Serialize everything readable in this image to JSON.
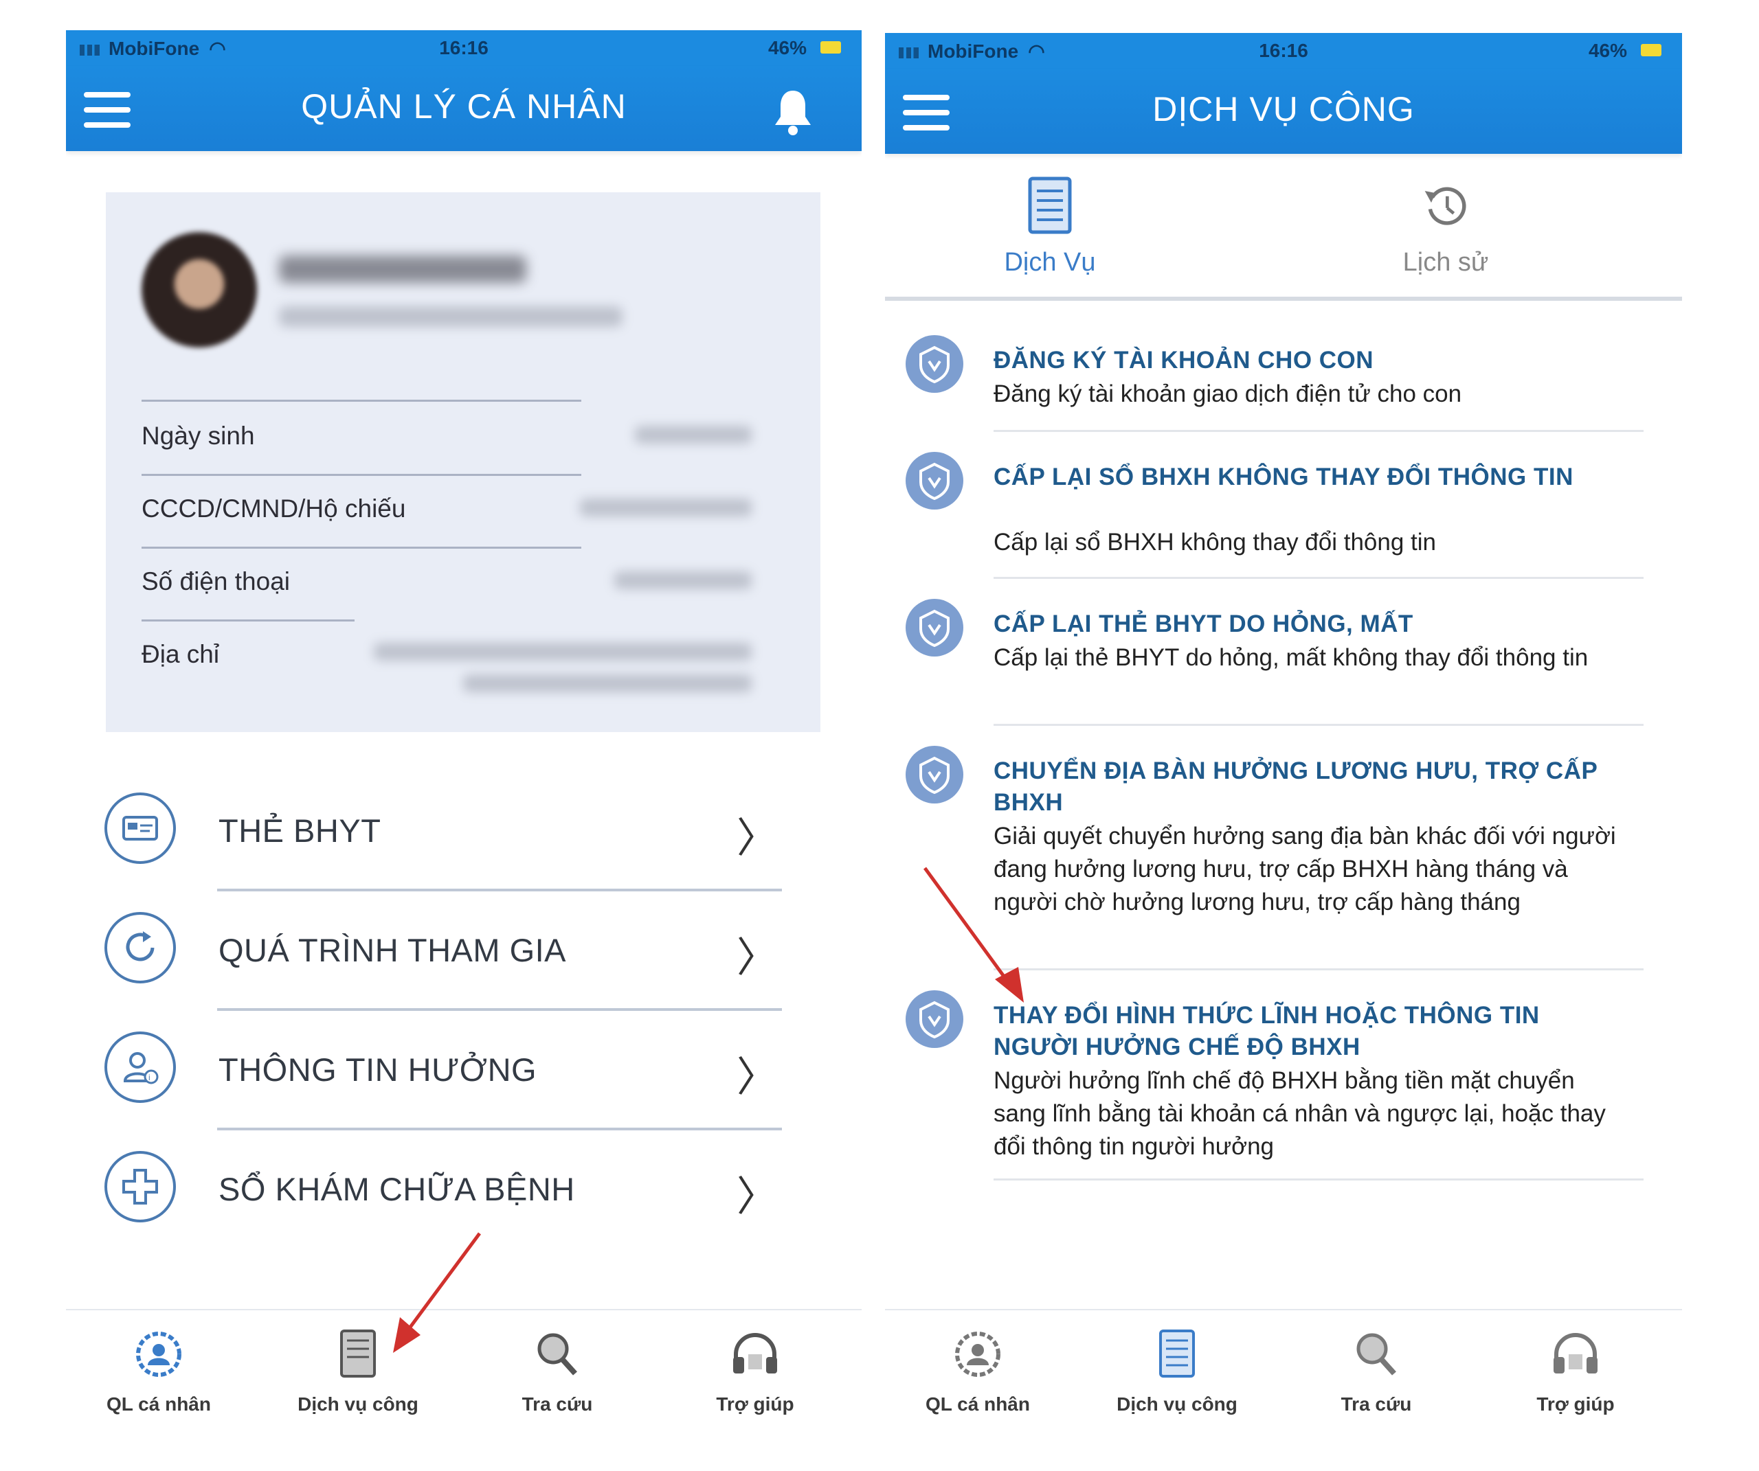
{
  "left": {
    "status": {
      "carrier": "MobiFone",
      "time": "16:16",
      "battery": "46%"
    },
    "title": "QUẢN LÝ CÁ NHÂN",
    "profile": {
      "rows": [
        {
          "label": "Ngày sinh"
        },
        {
          "label": "CCCD/CMND/Hộ chiếu"
        },
        {
          "label": "Số điện thoại"
        },
        {
          "label": "Địa chỉ"
        }
      ]
    },
    "menu": [
      {
        "label": "THẺ BHYT",
        "icon": "card-icon"
      },
      {
        "label": "QUÁ TRÌNH THAM GIA",
        "icon": "history-refresh-icon"
      },
      {
        "label": "THÔNG TIN HƯỞNG",
        "icon": "user-info-icon"
      },
      {
        "label": "SỔ KHÁM CHỮA BỆNH",
        "icon": "medical-cross-icon"
      }
    ],
    "nav": [
      {
        "label": "QL cá nhân",
        "icon": "profile-gear-icon"
      },
      {
        "label": "Dịch vụ công",
        "icon": "document-icon"
      },
      {
        "label": "Tra cứu",
        "icon": "search-magnifier-icon"
      },
      {
        "label": "Trợ giúp",
        "icon": "headset-icon"
      }
    ]
  },
  "right": {
    "status": {
      "carrier": "MobiFone",
      "time": "16:16",
      "battery": "46%"
    },
    "title": "DỊCH VỤ CÔNG",
    "tabs": [
      {
        "label": "Dịch Vụ",
        "icon": "document-icon",
        "active": true
      },
      {
        "label": "Lịch sử",
        "icon": "history-icon",
        "active": false
      }
    ],
    "services": [
      {
        "title": "ĐĂNG KÝ TÀI KHOẢN CHO CON",
        "desc": "Đăng ký tài khoản giao dịch điện tử cho con"
      },
      {
        "title": "CẤP LẠI SỔ BHXH KHÔNG THAY ĐỔI THÔNG TIN",
        "desc": "Cấp lại sổ BHXH không thay đổi thông tin"
      },
      {
        "title": "CẤP LẠI THẺ BHYT DO HỎNG, MẤT",
        "desc": "Cấp lại thẻ BHYT do hỏng, mất không thay đổi thông tin"
      },
      {
        "title": "CHUYỂN ĐỊA BÀN HƯỞNG LƯƠNG HƯU, TRỢ CẤP BHXH",
        "desc": "Giải quyết chuyển hưởng sang địa bàn khác đối với người đang hưởng lương hưu, trợ cấp BHXH hàng tháng và người chờ hưởng lương hưu, trợ cấp hàng tháng"
      },
      {
        "title": "THAY ĐỔI HÌNH THỨC LĨNH HOẶC THÔNG TIN NGƯỜI HƯỞNG CHẾ ĐỘ BHXH",
        "desc": "Người hưởng lĩnh chế độ BHXH bằng tiền mặt chuyển sang lĩnh bằng tài khoản cá nhân và ngược lại, hoặc thay đổi thông tin người hưởng"
      }
    ],
    "nav": [
      {
        "label": "QL cá nhân",
        "icon": "profile-gear-icon"
      },
      {
        "label": "Dịch vụ công",
        "icon": "document-icon"
      },
      {
        "label": "Tra cứu",
        "icon": "search-magnifier-icon"
      },
      {
        "label": "Trợ giúp",
        "icon": "headset-icon"
      }
    ]
  },
  "colors": {
    "header": "#1c8be0",
    "title_blue": "#1f5a8c",
    "arrow": "#d0312d",
    "active_tab": "#3a7cc8"
  }
}
